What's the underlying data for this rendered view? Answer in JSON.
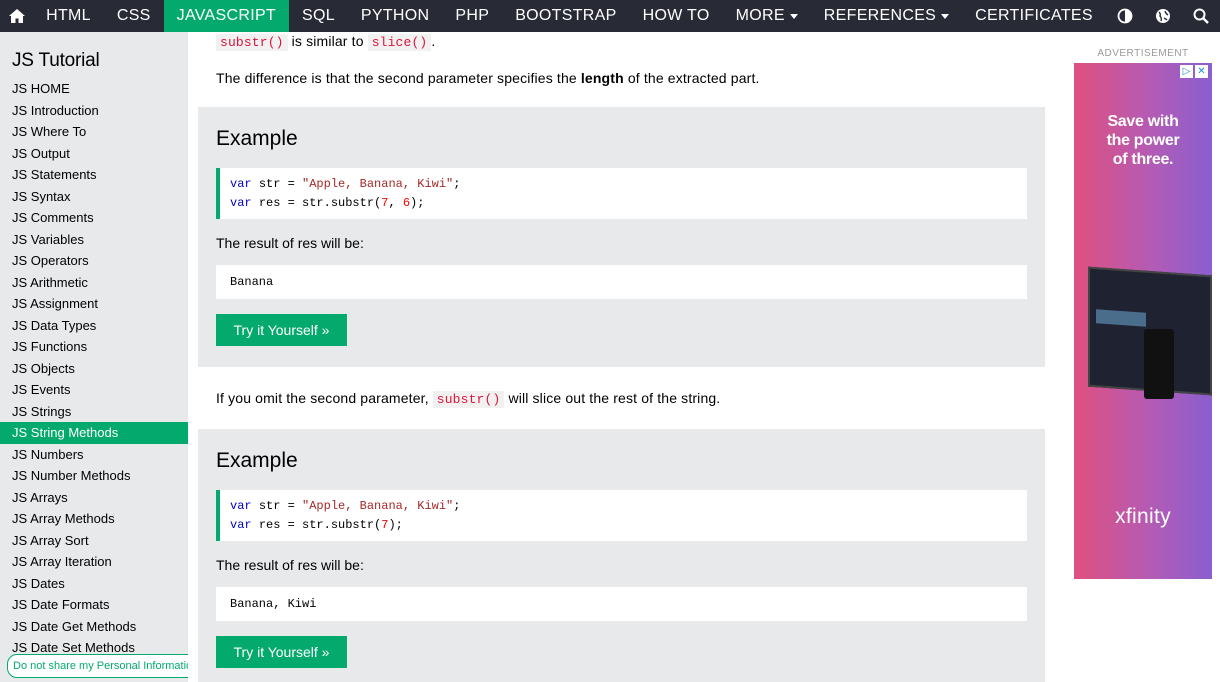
{
  "nav": {
    "items": [
      {
        "label": "HTML",
        "active": false
      },
      {
        "label": "CSS",
        "active": false
      },
      {
        "label": "JAVASCRIPT",
        "active": true
      },
      {
        "label": "SQL",
        "active": false
      },
      {
        "label": "PYTHON",
        "active": false
      },
      {
        "label": "PHP",
        "active": false
      },
      {
        "label": "BOOTSTRAP",
        "active": false
      },
      {
        "label": "HOW TO",
        "active": false
      },
      {
        "label": "MORE",
        "active": false,
        "dropdown": true
      },
      {
        "label": "REFERENCES",
        "active": false,
        "dropdown": true
      },
      {
        "label": "CERTIFICATES",
        "active": false
      }
    ],
    "icons": [
      "home-icon",
      "contrast-icon",
      "globe-icon",
      "search-icon"
    ]
  },
  "sidebar": {
    "title": "JS Tutorial",
    "items": [
      {
        "label": "JS HOME"
      },
      {
        "label": "JS Introduction"
      },
      {
        "label": "JS Where To"
      },
      {
        "label": "JS Output"
      },
      {
        "label": "JS Statements"
      },
      {
        "label": "JS Syntax"
      },
      {
        "label": "JS Comments"
      },
      {
        "label": "JS Variables"
      },
      {
        "label": "JS Operators"
      },
      {
        "label": "JS Arithmetic"
      },
      {
        "label": "JS Assignment"
      },
      {
        "label": "JS Data Types"
      },
      {
        "label": "JS Functions"
      },
      {
        "label": "JS Objects"
      },
      {
        "label": "JS Events"
      },
      {
        "label": "JS Strings"
      },
      {
        "label": "JS String Methods",
        "active": true
      },
      {
        "label": "JS Numbers"
      },
      {
        "label": "JS Number Methods"
      },
      {
        "label": "JS Arrays"
      },
      {
        "label": "JS Array Methods"
      },
      {
        "label": "JS Array Sort"
      },
      {
        "label": "JS Array Iteration"
      },
      {
        "label": "JS Dates"
      },
      {
        "label": "JS Date Formats"
      },
      {
        "label": "JS Date Get Methods"
      },
      {
        "label": "JS Date Set Methods"
      }
    ]
  },
  "privacy_link": "Do not share my Personal Information",
  "content": {
    "top_line": {
      "code1": "substr()",
      "text": "is similar to",
      "code2": "slice()",
      "end": "."
    },
    "difference": {
      "before": "The difference is that the second parameter specifies the",
      "bold": "length",
      "after": "of the extracted part."
    },
    "example1": {
      "heading": "Example",
      "line1": {
        "kw": "var",
        "rest": "str =",
        "str": "\"Apple, Banana, Kiwi\"",
        "end": ";"
      },
      "line2": {
        "kw": "var",
        "rest": "res = str.substr(",
        "n1": "7",
        "sep": ", ",
        "n2": "6",
        "end": ");"
      },
      "result_label": "The result of res will be:",
      "result": "Banana",
      "button": "Try it Yourself »"
    },
    "omit": {
      "before": "If you omit the second parameter,",
      "code": "substr()",
      "after": "will slice out the rest of the string."
    },
    "example2": {
      "heading": "Example",
      "line1": {
        "kw": "var",
        "rest": "str =",
        "str": "\"Apple, Banana, Kiwi\"",
        "end": ";"
      },
      "line2": {
        "kw": "var",
        "rest": "res = str.substr(",
        "n1": "7",
        "end": ");"
      },
      "result_label": "The result of res will be:",
      "result": "Banana, Kiwi",
      "button": "Try it Yourself »"
    }
  },
  "ad": {
    "label": "ADVERTISEMENT",
    "headline": "Save with\nthe power\nof three.",
    "brand": "xfinity",
    "colors": {
      "from": "#E0507F",
      "to": "#8A5FD0"
    }
  },
  "colors": {
    "nav_bg": "#282A35",
    "accent": "#04AA6D",
    "sidebar_bg": "#E7E9EB"
  }
}
